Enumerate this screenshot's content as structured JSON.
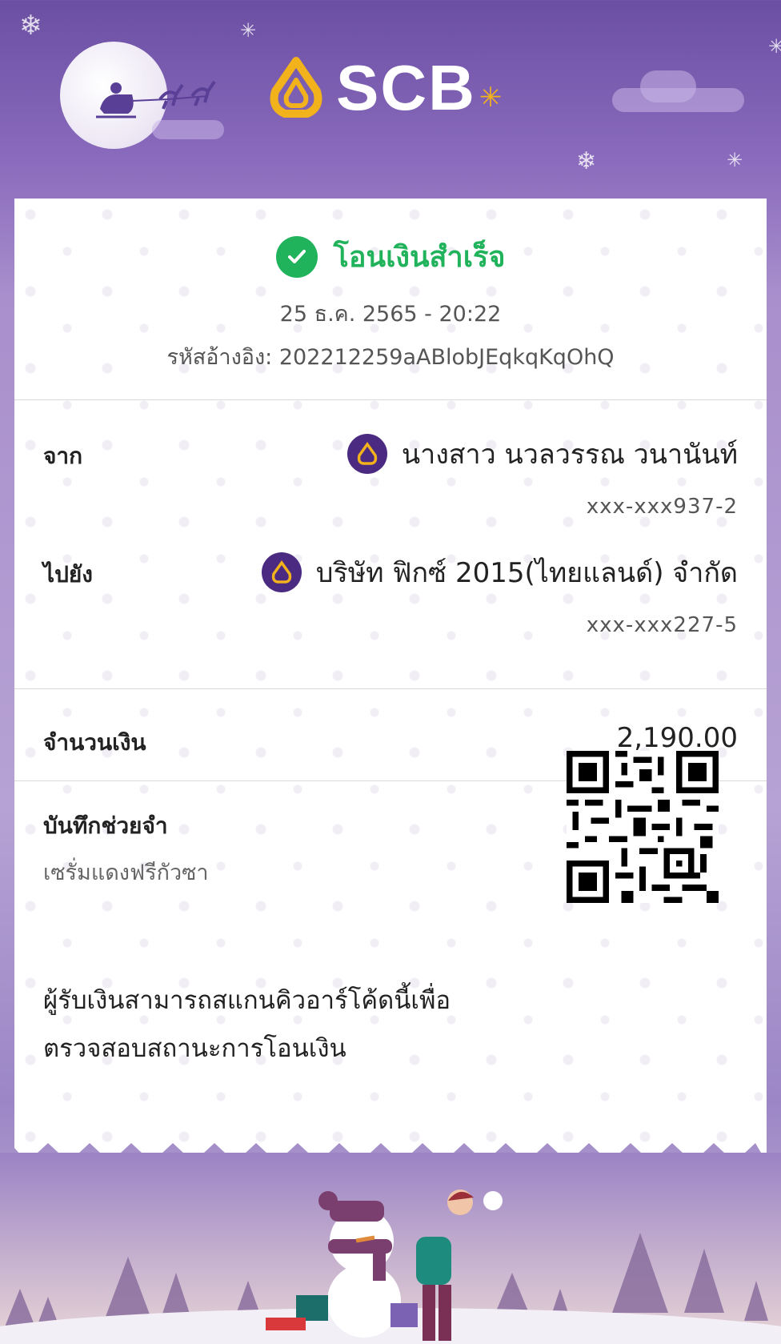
{
  "header": {
    "logo_text": "SCB"
  },
  "status": {
    "title": "โอนเงินสำเร็จ",
    "datetime": "25 ธ.ค. 2565 - 20:22",
    "reference": "รหัสอ้างอิง: 202212259aABlobJEqkqKqOhQ"
  },
  "from": {
    "label": "จาก",
    "name": "นางสาว นวลวรรณ วนานันท์",
    "account": "xxx-xxx937-2"
  },
  "to": {
    "label": "ไปยัง",
    "name": "บริษัท ฟิกซ์ 2015(ไทยแลนด์) จำกัด",
    "account": "xxx-xxx227-5"
  },
  "amount": {
    "label": "จำนวนเงิน",
    "value": "2,190.00"
  },
  "memo": {
    "label": "บันทึกช่วยจำ",
    "value": "เซรั่มแดงฟรีกัวซา"
  },
  "qr_section": {
    "line1": "ผู้รับเงินสามารถสแกนคิวอาร์โค้ดนี้เพื่อ",
    "line2": "ตรวจสอบสถานะการโอนเงิน"
  },
  "colors": {
    "brand_purple": "#4b2a82",
    "success_green": "#20b35b",
    "logo_gold": "#f2b21b"
  }
}
